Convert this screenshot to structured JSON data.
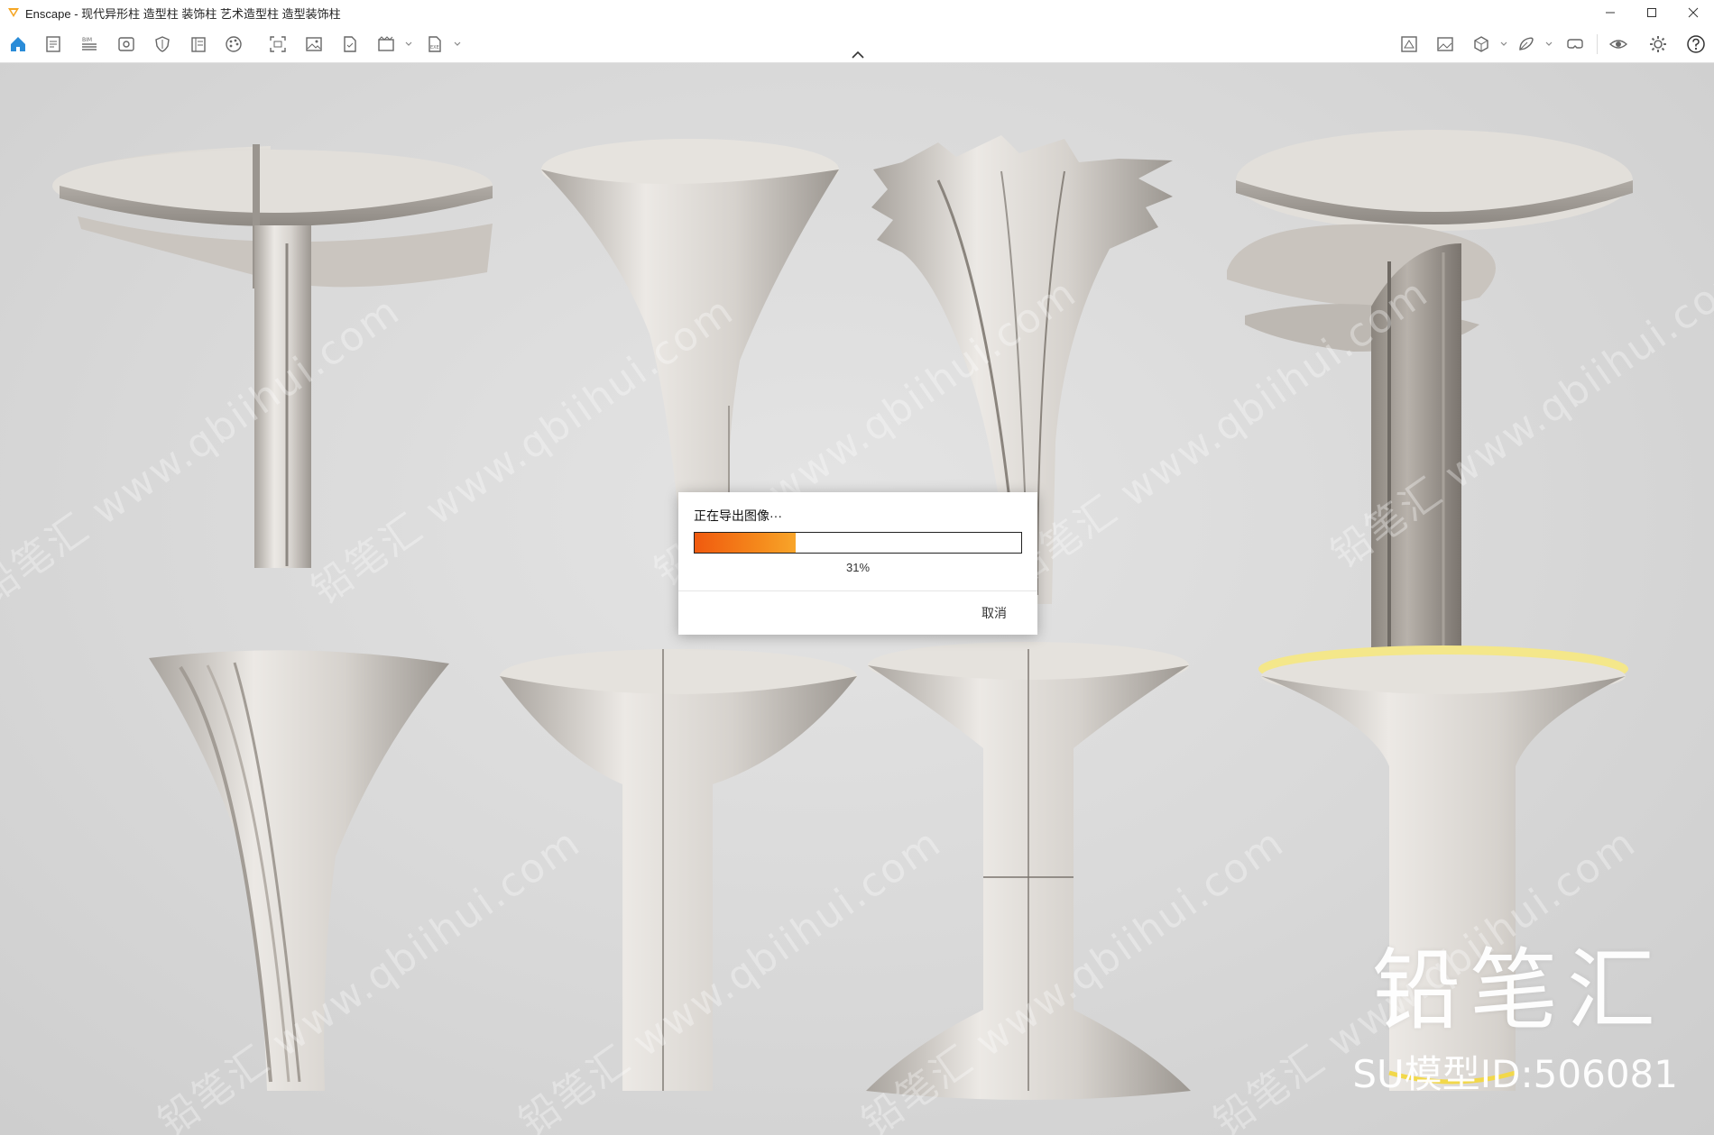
{
  "window": {
    "title": "Enscape - 现代异形柱 造型柱 装饰柱 艺术造型柱 造型装饰柱",
    "buttons": [
      "minimize-icon",
      "maximize-icon",
      "close-icon"
    ]
  },
  "toolbar": {
    "left_icons": [
      "home-icon",
      "notes-icon",
      "bim-icon",
      "view-icon",
      "shield-icon",
      "book-icon",
      "palette-icon",
      "screenshot-icon",
      "image-icon",
      "document-icon",
      "video-icon",
      "export-icon"
    ],
    "right_icons": [
      "asset-library-icon",
      "gallery-icon",
      "cube-icon",
      "material-editor-icon",
      "vr-headset-icon",
      "eye-icon",
      "settings-icon",
      "help-icon"
    ],
    "accent": "#2a8cd8"
  },
  "dialog": {
    "message": "正在导出图像···",
    "progress_fraction": 0.31,
    "progress_label": "31%",
    "cancel_label": "取消",
    "fill_color": "#f05a0f"
  },
  "watermark": {
    "text": "铅笔汇 www.qbiihui.com",
    "brand": "铅笔汇",
    "model_id": "SU模型ID:506081"
  }
}
